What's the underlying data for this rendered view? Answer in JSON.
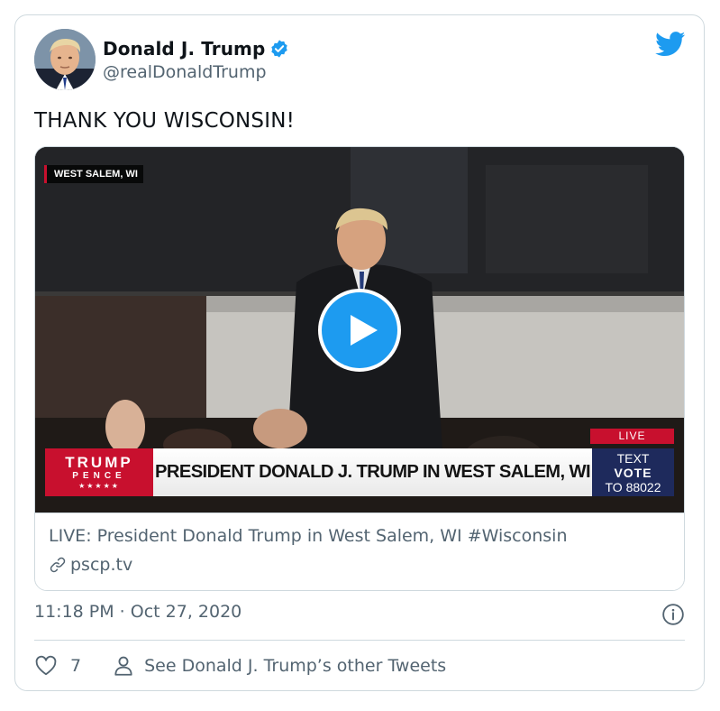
{
  "tweet": {
    "display_name": "Donald J. Trump",
    "handle": "@realDonaldTrump",
    "text": "THANK YOU WISCONSIN!",
    "timestamp": "11:18 PM · Oct 27, 2020",
    "likes": "7",
    "other_tweets_label": "See Donald J. Trump’s other Tweets"
  },
  "media": {
    "location_tag": "WEST SALEM, WI",
    "live_badge": "LIVE",
    "brand_line1": "TRUMP",
    "brand_line2": "PENCE",
    "brand_stars": "★★★★★",
    "headline": "PRESIDENT DONALD J. TRUMP IN WEST SALEM, WI",
    "cta_line1": "TEXT",
    "cta_line2": "VOTE",
    "cta_line3": "TO 88022"
  },
  "link_card": {
    "title": "LIVE: President Donald Trump in West Salem, WI #Wisconsin",
    "domain": "pscp.tv"
  },
  "icons": {
    "verified": "verified-badge-icon",
    "logo": "twitter-bird-icon",
    "play": "play-icon",
    "link": "link-icon",
    "info": "info-icon",
    "like": "heart-icon",
    "profile": "person-icon"
  },
  "colors": {
    "twitter_blue": "#1d9bf0",
    "secondary_text": "#536471",
    "border": "#cfd9de",
    "broadcast_red": "#c8102e",
    "broadcast_navy": "#1e2a5c"
  }
}
